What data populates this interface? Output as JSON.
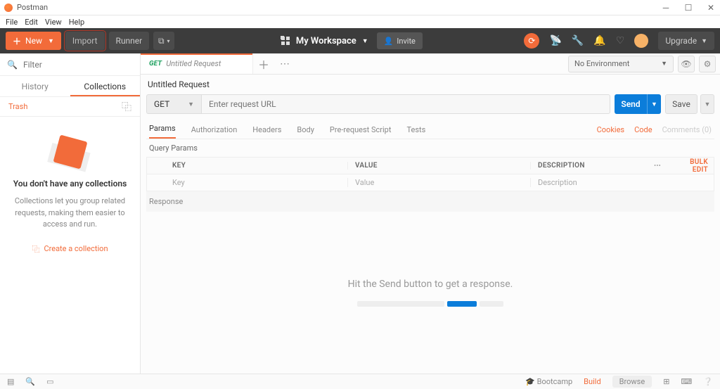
{
  "window": {
    "title": "Postman"
  },
  "menubar": [
    "File",
    "Edit",
    "View",
    "Help"
  ],
  "toolbar": {
    "new_label": "New",
    "import_label": "Import",
    "runner_label": "Runner",
    "workspace_label": "My Workspace",
    "invite_label": "Invite",
    "upgrade_label": "Upgrade"
  },
  "sidebar": {
    "filter_placeholder": "Filter",
    "tabs": {
      "history": "History",
      "collections": "Collections"
    },
    "trash_label": "Trash",
    "empty": {
      "heading": "You don't have any collections",
      "body": "Collections let you group related requests, making them easier to access and run.",
      "create_label": "Create a collection"
    }
  },
  "env": {
    "selected": "No Environment"
  },
  "request": {
    "tab_method": "GET",
    "tab_name": "Untitled Request",
    "title": "Untitled Request",
    "method": "GET",
    "url_placeholder": "Enter request URL",
    "send_label": "Send",
    "save_label": "Save",
    "subtabs": [
      "Params",
      "Authorization",
      "Headers",
      "Body",
      "Pre-request Script",
      "Tests"
    ],
    "links": {
      "cookies": "Cookies",
      "code": "Code",
      "comments": "Comments (0)"
    },
    "query_params_title": "Query Params",
    "table": {
      "headers": {
        "key": "KEY",
        "value": "VALUE",
        "description": "DESCRIPTION"
      },
      "placeholders": {
        "key": "Key",
        "value": "Value",
        "description": "Description"
      },
      "bulk_edit": "Bulk Edit"
    },
    "response_title": "Response",
    "response_hint": "Hit the Send button to get a response."
  },
  "statusbar": {
    "bootcamp": "Bootcamp",
    "build": "Build",
    "browse": "Browse"
  }
}
